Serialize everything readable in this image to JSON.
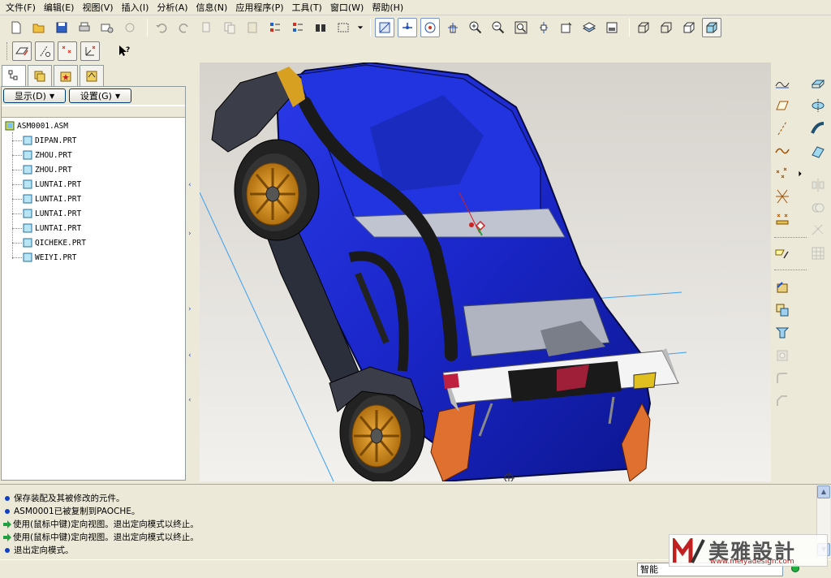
{
  "menu": [
    "文件(F)",
    "编辑(E)",
    "视图(V)",
    "插入(I)",
    "分析(A)",
    "信息(N)",
    "应用程序(P)",
    "工具(T)",
    "窗口(W)",
    "帮助(H)"
  ],
  "nav": {
    "show_button": "显示(D)",
    "settings_button": "设置(G)",
    "tree_root": "ASM0001.ASM",
    "tree_items": [
      "DIPAN.PRT",
      "ZHOU.PRT",
      "ZHOU.PRT",
      "LUNTAI.PRT",
      "LUNTAI.PRT",
      "LUNTAI.PRT",
      "LUNTAI.PRT",
      "QICHEKE.PRT",
      "WEIYI.PRT"
    ]
  },
  "messages": [
    {
      "type": "info",
      "text": "保存装配及其被修改的元件。"
    },
    {
      "type": "info",
      "text": "ASM0001已被复制到PAOCHE。"
    },
    {
      "type": "prompt",
      "text": "使用(鼠标中键)定向视图。退出定向模式以终止。"
    },
    {
      "type": "prompt",
      "text": "使用(鼠标中键)定向视图。退出定向模式以终止。"
    },
    {
      "type": "info",
      "text": "退出定向模式。"
    }
  ],
  "status": {
    "filter_value": "智能"
  },
  "watermark": {
    "title": "美雅設計",
    "url": "www.meiyadesign.com"
  },
  "colors": {
    "car_body": "#1a2ad8",
    "wheel_rim": "#d8901a",
    "accent_orange": "#e07030",
    "datum_axis": "#3aa0f0"
  }
}
